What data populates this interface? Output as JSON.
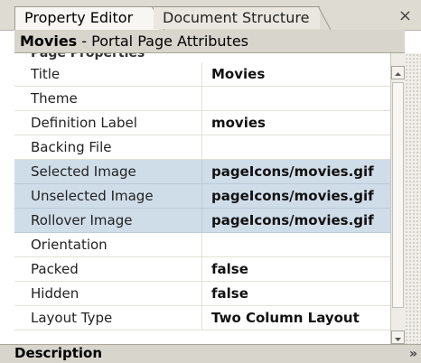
{
  "tabs": {
    "active": "Property Editor",
    "inactive": "Document Structure",
    "close": "×"
  },
  "header": {
    "name": "Movies",
    "rest": " - Portal Page Attributes"
  },
  "section": {
    "label": "Page Properties"
  },
  "properties": [
    {
      "name": "Title",
      "value": "Movies",
      "selected": false
    },
    {
      "name": "Theme",
      "value": "",
      "selected": false
    },
    {
      "name": "Definition Label",
      "value": "movies",
      "selected": false
    },
    {
      "name": "Backing File",
      "value": "",
      "selected": false
    },
    {
      "name": "Selected Image",
      "value": "pageIcons/movies.gif",
      "selected": true
    },
    {
      "name": "Unselected Image",
      "value": "pageIcons/movies.gif",
      "selected": true
    },
    {
      "name": "Rollover Image",
      "value": "pageIcons/movies.gif",
      "selected": true
    },
    {
      "name": "Orientation",
      "value": "",
      "selected": false
    },
    {
      "name": "Packed",
      "value": "false",
      "selected": false
    },
    {
      "name": "Hidden",
      "value": "false",
      "selected": false
    },
    {
      "name": "Layout Type",
      "value": "Two Column Layout",
      "selected": false
    }
  ],
  "description": {
    "label": "Description",
    "chevron": "»"
  },
  "colors": {
    "selected_row": "#cfdde9",
    "panel_gray": "#d7d5cc"
  }
}
